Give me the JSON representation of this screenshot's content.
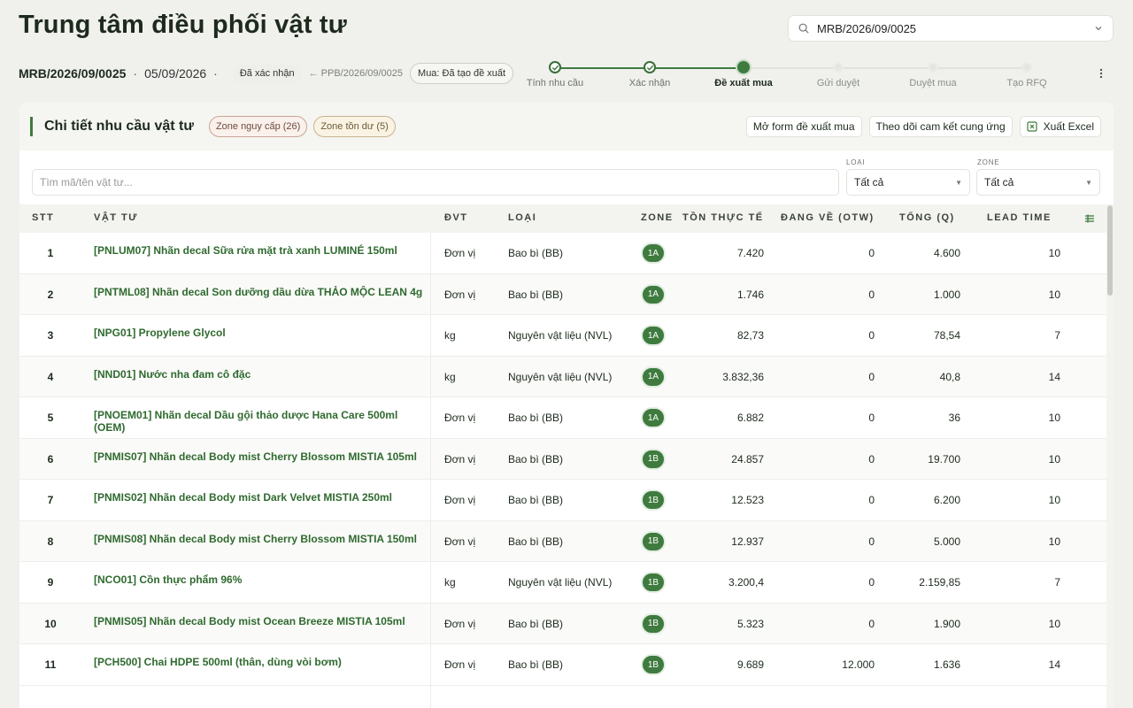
{
  "page": {
    "title": "Trung tâm điều phối vật tư"
  },
  "search": {
    "value": "MRB/2026/09/0025"
  },
  "meta": {
    "code": "MRB/2026/09/0025",
    "date": "05/09/2026",
    "status": "Đã xác nhận",
    "prev_link": "← PPB/2026/09/0025",
    "purchase_status": "Mua: Đã tạo đề xuất"
  },
  "stepper": {
    "steps": [
      {
        "label": "Tính nhu cầu",
        "state": "done"
      },
      {
        "label": "Xác nhận",
        "state": "done"
      },
      {
        "label": "Đề xuất mua",
        "state": "active"
      },
      {
        "label": "Gửi duyệt",
        "state": "todo"
      },
      {
        "label": "Duyệt mua",
        "state": "todo"
      },
      {
        "label": "Tạo RFQ",
        "state": "todo"
      }
    ]
  },
  "card": {
    "title": "Chi tiết nhu cầu vật tư",
    "zone_danger": "Zone nguy cấp (26)",
    "zone_surplus": "Zone tồn dư (5)",
    "btn_open_form": "Mở form đề xuất mua",
    "btn_track": "Theo dõi cam kết cung ứng",
    "btn_excel": "Xuất Excel"
  },
  "filters": {
    "search_placeholder": "Tìm mã/tên vật tư...",
    "type_label": "LOẠI",
    "type_value": "Tất cả",
    "zone_label": "ZONE",
    "zone_value": "Tất cả"
  },
  "table": {
    "headers": {
      "stt": "STT",
      "item": "VẬT TƯ",
      "unit": "ĐVT",
      "type": "LOẠI",
      "zone": "ZONE",
      "stock": "TỒN THỰC TẾ",
      "otw": "ĐANG VỀ (OTW)",
      "total": "TỔNG (Q)",
      "lead": "LEAD TIME"
    },
    "rows": [
      {
        "stt": "1",
        "name": "[PNLUM07] Nhãn decal Sữa rửa mặt trà xanh LUMINÉ 150ml",
        "unit": "Đơn vị",
        "type": "Bao bì (BB)",
        "zone": "1A",
        "stock": "7.420",
        "otw": "0",
        "total": "4.600",
        "lead": "10"
      },
      {
        "stt": "2",
        "name": "[PNTML08] Nhãn decal Son dưỡng dầu dừa THẢO MỘC LEAN 4g",
        "unit": "Đơn vị",
        "type": "Bao bì (BB)",
        "zone": "1A",
        "stock": "1.746",
        "otw": "0",
        "total": "1.000",
        "lead": "10"
      },
      {
        "stt": "3",
        "name": "[NPG01] Propylene Glycol",
        "unit": "kg",
        "type": "Nguyên vật liệu (NVL)",
        "zone": "1A",
        "stock": "82,73",
        "otw": "0",
        "total": "78,54",
        "lead": "7"
      },
      {
        "stt": "4",
        "name": "[NND01] Nước nha đam cô đặc",
        "unit": "kg",
        "type": "Nguyên vật liệu (NVL)",
        "zone": "1A",
        "stock": "3.832,36",
        "otw": "0",
        "total": "40,8",
        "lead": "14"
      },
      {
        "stt": "5",
        "name": "[PNOEM01] Nhãn decal Dầu gội thảo dược Hana Care 500ml (OEM)",
        "unit": "Đơn vị",
        "type": "Bao bì (BB)",
        "zone": "1A",
        "stock": "6.882",
        "otw": "0",
        "total": "36",
        "lead": "10"
      },
      {
        "stt": "6",
        "name": "[PNMIS07] Nhãn decal Body mist Cherry Blossom MISTIA 105ml",
        "unit": "Đơn vị",
        "type": "Bao bì (BB)",
        "zone": "1B",
        "stock": "24.857",
        "otw": "0",
        "total": "19.700",
        "lead": "10"
      },
      {
        "stt": "7",
        "name": "[PNMIS02] Nhãn decal Body mist Dark Velvet MISTIA 250ml",
        "unit": "Đơn vị",
        "type": "Bao bì (BB)",
        "zone": "1B",
        "stock": "12.523",
        "otw": "0",
        "total": "6.200",
        "lead": "10"
      },
      {
        "stt": "8",
        "name": "[PNMIS08] Nhãn decal Body mist Cherry Blossom MISTIA 150ml",
        "unit": "Đơn vị",
        "type": "Bao bì (BB)",
        "zone": "1B",
        "stock": "12.937",
        "otw": "0",
        "total": "5.000",
        "lead": "10"
      },
      {
        "stt": "9",
        "name": "[NCO01] Cồn thực phẩm 96%",
        "unit": "kg",
        "type": "Nguyên vật liệu (NVL)",
        "zone": "1B",
        "stock": "3.200,4",
        "otw": "0",
        "total": "2.159,85",
        "lead": "7"
      },
      {
        "stt": "10",
        "name": "[PNMIS05] Nhãn decal Body mist Ocean Breeze MISTIA 105ml",
        "unit": "Đơn vị",
        "type": "Bao bì (BB)",
        "zone": "1B",
        "stock": "5.323",
        "otw": "0",
        "total": "1.900",
        "lead": "10"
      },
      {
        "stt": "11",
        "name": "[PCH500] Chai HDPE 500ml (thân, dùng vòi bơm)",
        "unit": "Đơn vị",
        "type": "Bao bì (BB)",
        "zone": "1B",
        "stock": "9.689",
        "otw": "12.000",
        "total": "1.636",
        "lead": "14"
      }
    ]
  },
  "colors": {
    "accent": "#3f7b3f",
    "link": "#2f6a2f"
  }
}
